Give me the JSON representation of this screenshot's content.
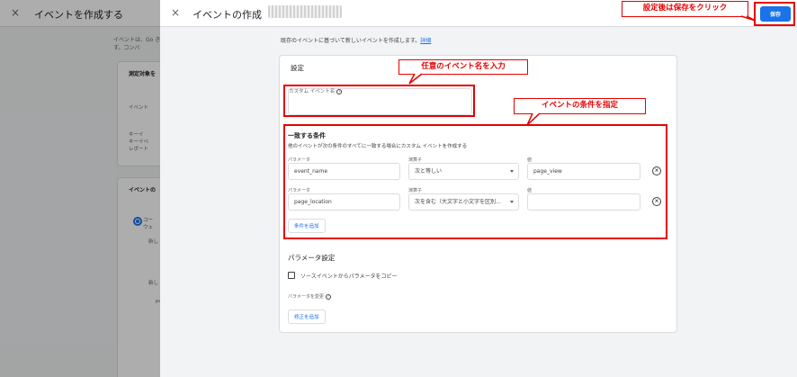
{
  "background": {
    "close_icon": "×",
    "title": "イベントを作成する",
    "description": "イベントは、Go きます。コンバ",
    "card1": {
      "title": "測定対象を",
      "line": "イベント"
    },
    "card2": {
      "line1": "キーイ",
      "line2": "キーイベ",
      "line3": "レポート"
    },
    "card3": {
      "title": "イベントの",
      "line1": "コー",
      "line2": "ウェ",
      "line3": "新し",
      "line4": "新し",
      "line5": "pa"
    }
  },
  "drawer": {
    "close_icon": "×",
    "title": "イベントの作成",
    "save_button": "保存",
    "intro_text": "既存のイベントに基づいて新しいイベントを作成します。",
    "intro_link": "詳細",
    "settings_title": "設定",
    "custom_event_name_label": "カスタム イベント名",
    "help_icon": "?",
    "conditions": {
      "title": "一致する条件",
      "description": "他のイベントが次の条件のすべてに一致する場合にカスタム イベントを作成する",
      "rows": [
        {
          "param_label": "パラメータ",
          "param": "event_name",
          "op_label": "演算子",
          "op": "次と等しい",
          "value_label": "値",
          "value": "page_view"
        },
        {
          "param_label": "パラメータ",
          "param": "page_location",
          "op_label": "演算子",
          "op": "次を含む（大文字と小文字を区別...",
          "value_label": "値",
          "value": ""
        }
      ],
      "add_button": "条件を追加",
      "remove_icon": "×"
    },
    "param_settings": {
      "title": "パラメータ設定",
      "copy_checkbox_label": "ソースイベントからパラメータをコピー",
      "modify_label": "パラメータを変更",
      "add_modification_button": "修正を追加"
    }
  },
  "annotations": {
    "save_hint": "設定後は保存をクリック",
    "name_hint": "任意のイベント名を入力",
    "condition_hint": "イベントの条件を指定",
    "color": "#e60000"
  }
}
